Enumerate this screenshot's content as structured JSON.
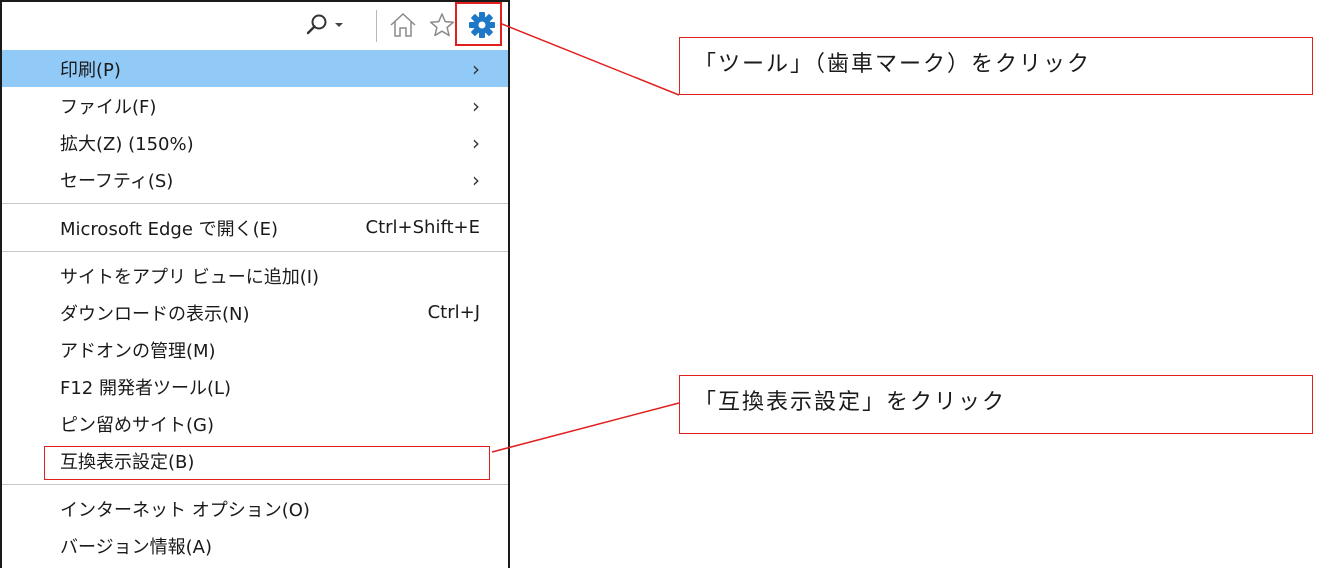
{
  "menu": {
    "items": [
      {
        "label": "印刷(P)",
        "submenu": true,
        "highlighted": true
      },
      {
        "label": "ファイル(F)",
        "submenu": true
      },
      {
        "label": "拡大(Z) (150%)",
        "submenu": true
      },
      {
        "label": "セーフティ(S)",
        "submenu": true
      },
      {
        "label": "Microsoft Edge で開く(E)",
        "shortcut": "Ctrl+Shift+E"
      },
      {
        "label": "サイトをアプリ ビューに追加(I)"
      },
      {
        "label": "ダウンロードの表示(N)",
        "shortcut": "Ctrl+J"
      },
      {
        "label": "アドオンの管理(M)"
      },
      {
        "label": "F12 開発者ツール(L)"
      },
      {
        "label": "ピン留めサイト(G)"
      },
      {
        "label": "互換表示設定(B)"
      },
      {
        "label": "インターネット オプション(O)"
      },
      {
        "label": "バージョン情報(A)"
      }
    ]
  },
  "toolbar": {
    "icons": [
      "search-icon",
      "dropdown-arrow-icon",
      "home-icon",
      "favorites-star-icon",
      "tools-gear-icon"
    ]
  },
  "annotations": {
    "tools_callout": "「ツール」（歯車マーク）をクリック",
    "compat_callout": "「互換表示設定」をクリック"
  },
  "colors": {
    "highlight": "#91c9f7",
    "annotation_red": "#e0201f",
    "gear_blue": "#1e78c8"
  }
}
